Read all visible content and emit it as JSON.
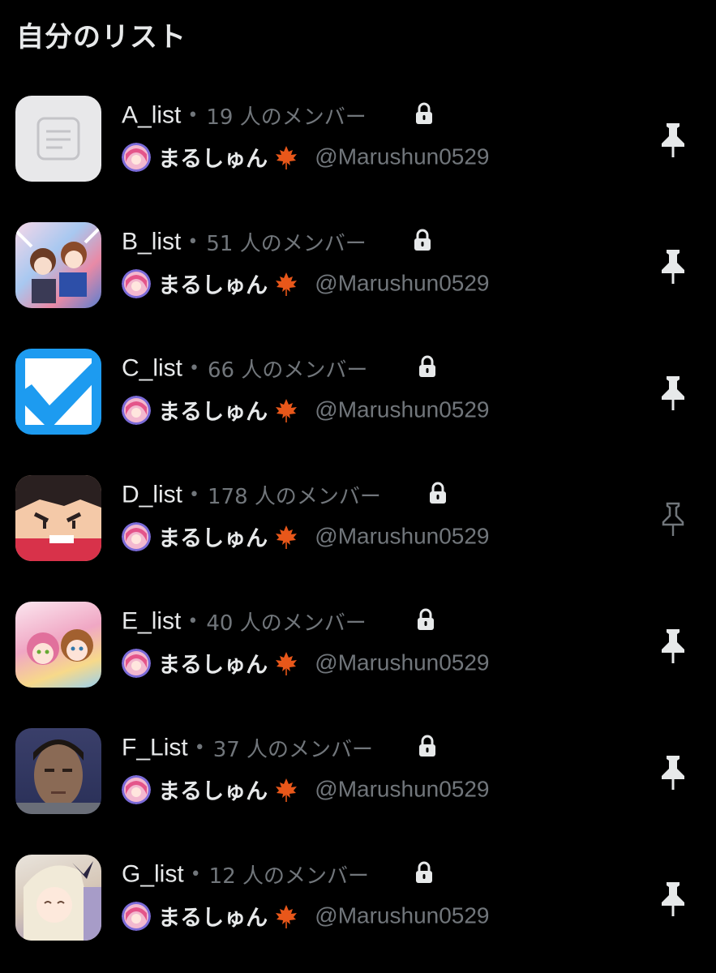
{
  "header": {
    "title": "自分のリスト"
  },
  "owner": {
    "display_name": "まるしゅん",
    "handle": "@Marushun0529"
  },
  "lists": [
    {
      "name": "A_list",
      "members": "19 人のメンバー",
      "pinned": true,
      "thumb": "list-placeholder"
    },
    {
      "name": "B_list",
      "members": "51 人のメンバー",
      "pinned": true,
      "thumb": "anime-characters"
    },
    {
      "name": "C_list",
      "members": "66 人のメンバー",
      "pinned": true,
      "thumb": "checkmark"
    },
    {
      "name": "D_list",
      "members": "178 人のメンバー",
      "pinned": false,
      "thumb": "cartoon-face"
    },
    {
      "name": "E_list",
      "members": "40 人のメンバー",
      "pinned": true,
      "thumb": "anime-girls"
    },
    {
      "name": "F_List",
      "members": "37 人のメンバー",
      "pinned": true,
      "thumb": "person-photo"
    },
    {
      "name": "G_list",
      "members": "12 人のメンバー",
      "pinned": true,
      "thumb": "anime-girl"
    }
  ],
  "colors": {
    "background": "#000000",
    "text": "#e7e9ea",
    "muted": "#71767b",
    "check_blue": "#1d9bf0"
  }
}
